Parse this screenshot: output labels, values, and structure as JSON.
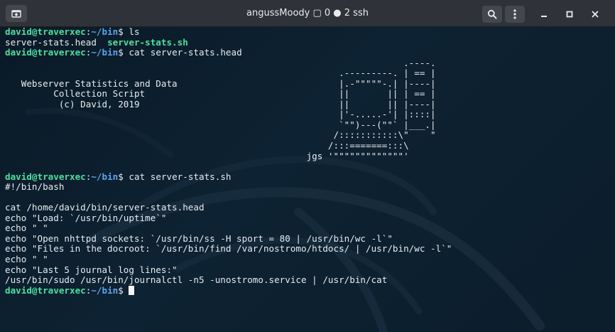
{
  "titlebar": {
    "title": "angussMoody ▢ 0 ● 2 ssh",
    "icons": {
      "new_tab": "new-tab-icon",
      "search": "search-icon",
      "menu": "kebab-menu-icon",
      "minimize": "minimize-icon",
      "maximize": "maximize-icon",
      "close": "close-icon"
    }
  },
  "colors": {
    "prompt_user": "#4ee0a2",
    "prompt_path": "#5ba4ec",
    "text": "#e8ecef",
    "background": "#0b1a27",
    "titlebar": "#2f3339"
  },
  "terminal": {
    "prompt": {
      "user": "david@traverxec",
      "sep": ":",
      "path": "~/bin",
      "symbol": "$"
    },
    "lines": [
      {
        "type": "prompt",
        "cmd": " ls"
      },
      {
        "type": "ls",
        "plain": "server-stats.head  ",
        "exec": "server-stats.sh"
      },
      {
        "type": "prompt",
        "cmd": " cat server-stats.head"
      },
      {
        "type": "text",
        "text": "                                                                          .----."
      },
      {
        "type": "text",
        "text": "                                                              .---------. | == |"
      },
      {
        "type": "text",
        "text": "   Webserver Statistics and Data                              |.-\"\"\"\"\"-.| |----|"
      },
      {
        "type": "text",
        "text": "         Collection Script                                    ||       || | == |"
      },
      {
        "type": "text",
        "text": "          (c) David, 2019                                     ||       || |----|"
      },
      {
        "type": "text",
        "text": "                                                              |'-.....-'| |::::|"
      },
      {
        "type": "text",
        "text": "                                                              `\"\")---(\"\"` |___.|"
      },
      {
        "type": "text",
        "text": "                                                             /:::::::::::\\\"    \""
      },
      {
        "type": "text",
        "text": "                                                            /:::=======:::\\"
      },
      {
        "type": "text",
        "text": "                                                        jgs '\"\"\"\"\"\"\"\"\"\"\"\"\"'"
      },
      {
        "type": "text",
        "text": ""
      },
      {
        "type": "prompt",
        "cmd": " cat server-stats.sh"
      },
      {
        "type": "text",
        "text": "#!/bin/bash"
      },
      {
        "type": "text",
        "text": ""
      },
      {
        "type": "text",
        "text": "cat /home/david/bin/server-stats.head"
      },
      {
        "type": "text",
        "text": "echo \"Load: `/usr/bin/uptime`\""
      },
      {
        "type": "text",
        "text": "echo \" \""
      },
      {
        "type": "text",
        "text": "echo \"Open nhttpd sockets: `/usr/bin/ss -H sport = 80 | /usr/bin/wc -l`\""
      },
      {
        "type": "text",
        "text": "echo \"Files in the docroot: `/usr/bin/find /var/nostromo/htdocs/ | /usr/bin/wc -l`\""
      },
      {
        "type": "text",
        "text": "echo \" \""
      },
      {
        "type": "text",
        "text": "echo \"Last 5 journal log lines:\""
      },
      {
        "type": "text",
        "text": "/usr/bin/sudo /usr/bin/journalctl -n5 -unostromo.service | /usr/bin/cat"
      },
      {
        "type": "prompt",
        "cmd": " ",
        "cursor": true
      }
    ]
  }
}
